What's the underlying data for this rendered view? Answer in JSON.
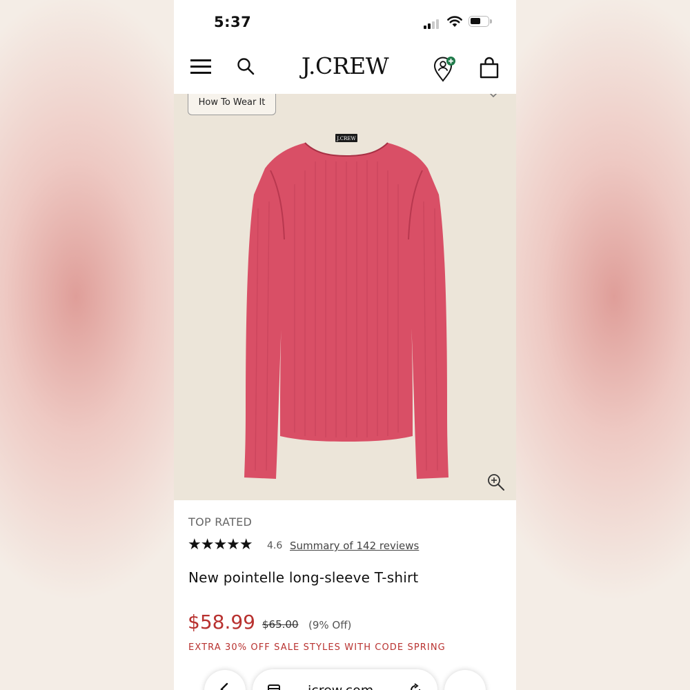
{
  "status_bar": {
    "time": "5:37"
  },
  "header": {
    "brand": "J.CREW",
    "menu_icon": "hamburger-menu-icon",
    "search_icon": "search-icon",
    "account_icon": "account-plus-icon",
    "bag_icon": "shopping-bag-icon"
  },
  "hero": {
    "how_to_wear_label": "How To Wear It",
    "wishlist_icon": "heart-icon",
    "zoom_icon": "zoom-in-icon",
    "product_color": "#d94f66",
    "shirt_label": "J.CREW"
  },
  "product": {
    "badge": "TOP RATED",
    "rating": {
      "stars_text": "★★★★★",
      "value": "4.6",
      "value_numeric": 4.6,
      "max": 5,
      "summary_link": "Summary of 142 reviews"
    },
    "title": "New pointelle long-sleeve T-shirt",
    "price": "$58.99",
    "original_price": "$65.00",
    "discount": "(9% Off)",
    "promo": "EXTRA 30% OFF SALE STYLES WITH CODE SPRING",
    "sale_color": "#b8312f"
  },
  "browser_bar": {
    "url": "jcrew.com"
  }
}
